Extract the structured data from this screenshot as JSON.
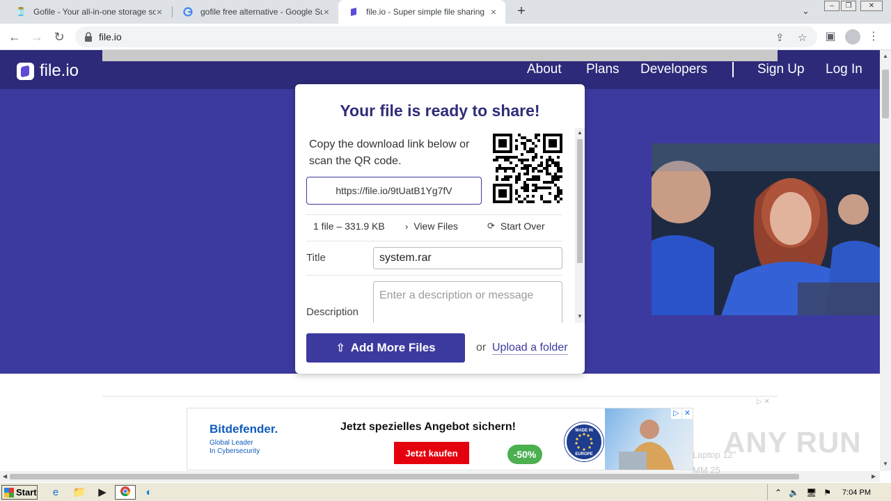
{
  "browser": {
    "tabs": [
      {
        "title": "Gofile - Your all-in-one storage soluti",
        "active": false
      },
      {
        "title": "gofile free alternative - Google Suche",
        "active": false
      },
      {
        "title": "file.io - Super simple file sharing",
        "active": true
      }
    ],
    "url": "file.io"
  },
  "site": {
    "logo_text": "file.io",
    "nav": [
      "About",
      "Plans",
      "Developers",
      "Sign Up",
      "Log In"
    ]
  },
  "card": {
    "title": "Your file is ready to share!",
    "copy_text": "Copy the download link below or scan the QR code.",
    "link": "https://file.io/9tUatB1Yg7fV",
    "file_info": "1 file – 331.9 KB",
    "view_files": "View Files",
    "start_over": "Start Over",
    "title_label": "Title",
    "title_value": "system.rar",
    "description_label": "Description",
    "description_placeholder": "Enter a description or message",
    "add_more_files": "Add More Files",
    "or": "or",
    "upload_folder": "Upload a folder"
  },
  "ad": {
    "brand": "Bitdefender.",
    "tagline_line1": "Global Leader",
    "tagline_line2": "In Cybersecurity",
    "headline": "Jetzt spezielles Angebot sichern!",
    "cta": "Jetzt kaufen",
    "discount": "-50%",
    "seal_top": "MADE IN",
    "seal_bottom": "EUROPE"
  },
  "watermark": "ANY RUN",
  "ghost_text_1": "Laptop 12\"",
  "ghost_text_2": "MM 25",
  "taskbar": {
    "start": "Start",
    "clock": "7:04 PM"
  },
  "colors": {
    "header": "#2d2a7a",
    "hero": "#3d3a9f",
    "accent": "#3d3a9f",
    "ad_cta": "#e5000d",
    "ad_discount": "#4caf50"
  }
}
